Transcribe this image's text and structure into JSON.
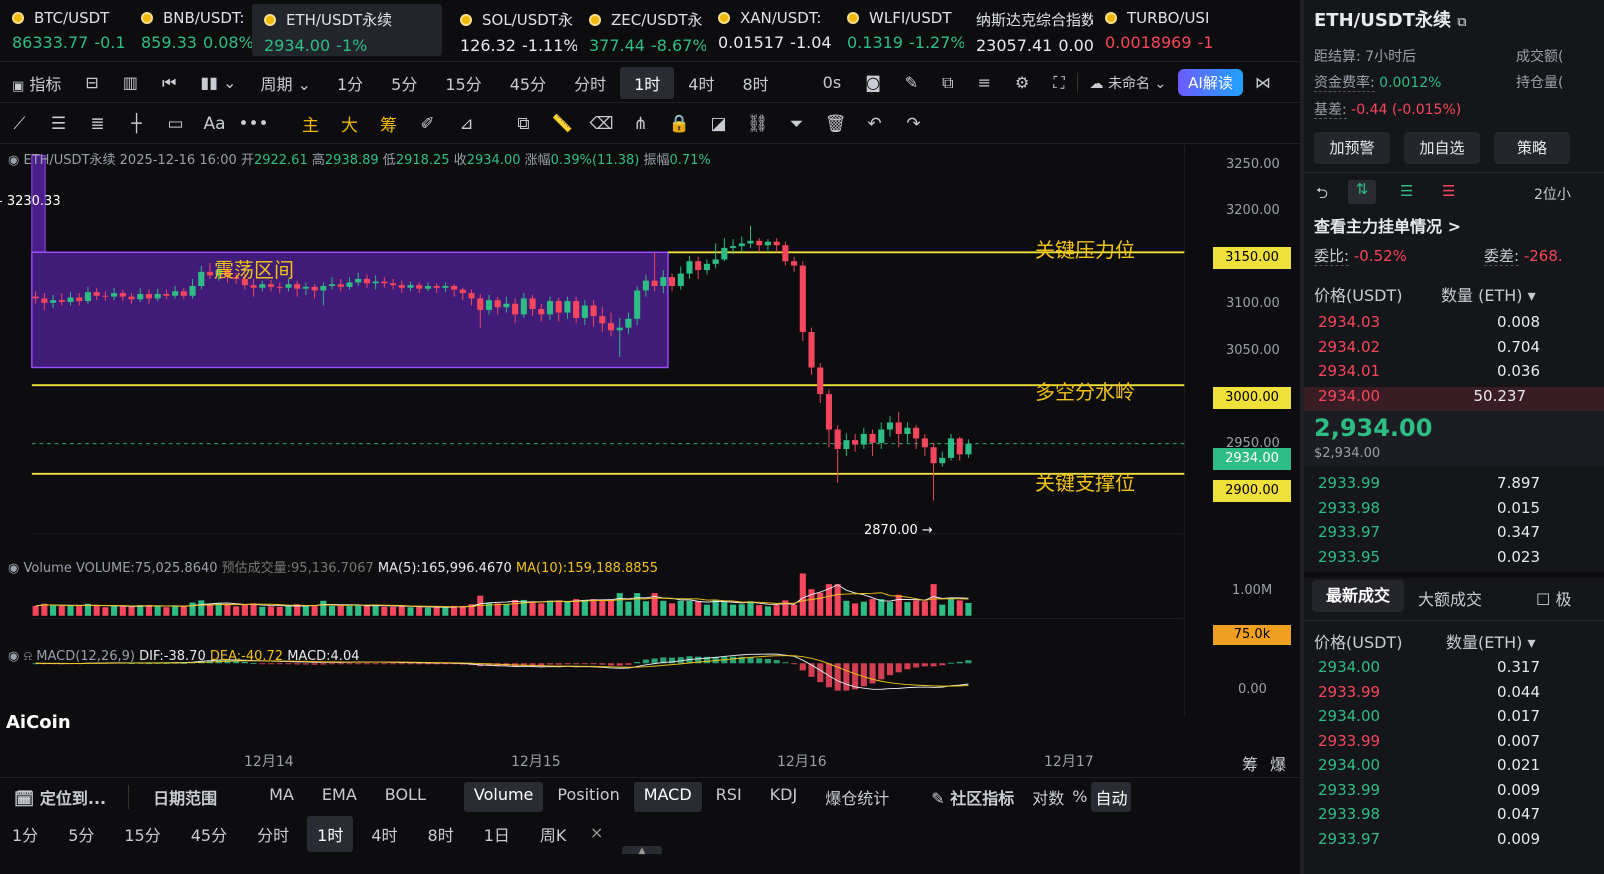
{
  "tickers": [
    {
      "name": "BTC/USDT",
      "price": "86333.77",
      "change": "-0.1",
      "pc": "green"
    },
    {
      "name": "BNB/USDT:",
      "price": "859.33",
      "change": "0.08%",
      "pc": "green"
    },
    {
      "name": "ETH/USDT永续",
      "price": "2934.00",
      "change": "-1%",
      "pc": "green",
      "active": true
    },
    {
      "name": "SOL/USDT永",
      "price": "126.32",
      "change": "-1.11%",
      "pc": "w"
    },
    {
      "name": "ZEC/USDT永",
      "price": "377.44",
      "change": "-8.67%",
      "pc": "green"
    },
    {
      "name": "XAN/USDT:",
      "price": "0.01517",
      "change": "-1.04",
      "pc": "w"
    },
    {
      "name": "WLFI/USDT",
      "price": "0.1319",
      "change": "-1.27%",
      "pc": "green"
    },
    {
      "name": "纳斯达克综合指数",
      "price": "23057.41",
      "change": "0.00",
      "pc": "w",
      "noicon": true
    },
    {
      "name": "TURBO/USI",
      "price": "0.0018969",
      "change": "-1",
      "pc": "r"
    }
  ],
  "plus_icon": "plus-icon",
  "toolbar1": {
    "indicator": "指标",
    "period": "周期",
    "tf": [
      "1分",
      "5分",
      "15分",
      "45分",
      "分时",
      "1时",
      "4时",
      "8时"
    ],
    "selected_tf": "1时",
    "zero_s": "0s",
    "layout_name": "未命名",
    "ai": "AI解读"
  },
  "toolbar2": {
    "main": "主",
    "big": "大",
    "chip": "筹",
    "text_tool": "Aa"
  },
  "info": {
    "symbol": "ETH/USDT永续",
    "time": "2025-12-16 16:00",
    "open_label": "开",
    "open": "2922.61",
    "high_label": "高",
    "high": "2938.89",
    "low_label": "低",
    "low": "2918.25",
    "close_label": "收",
    "close": "2934.00",
    "chg_label": "涨幅",
    "chg": "0.39%(11.38)",
    "amp_label": "振幅",
    "amp": "0.71%"
  },
  "annotations": {
    "range": "震荡区间",
    "resistance": "关键压力位",
    "divide": "多空分水岭",
    "support": "关键支撑位",
    "prev_high": "3230.33",
    "low_mark": "2870.00 →"
  },
  "price_axis": [
    "3250.00",
    "3200.00",
    "3150.00",
    "3100.00",
    "3050.00",
    "3000.00",
    "2950.00",
    "2934.00",
    "2900.00"
  ],
  "level_tags": {
    "l3150": "3150.00",
    "l3000": "3000.00",
    "l2934": "2934.00",
    "l2900": "2900.00"
  },
  "volume": {
    "label": "Volume",
    "vol": "VOLUME:75,025.8640",
    "est": "预估成交量:95,136.7067",
    "ma5": "MA(5):165,996.4670",
    "ma10": "MA(10):159,188.8855",
    "axis": "1.00M",
    "tag": "75.0k"
  },
  "macd": {
    "label": "MACD(12,26,9)",
    "dif": "DIF:-38.70",
    "dea": "DEA:-40.72",
    "macd": "MACD:4.04",
    "axis": "0.00"
  },
  "watermark": "AiCoin",
  "dates": [
    "12月14",
    "12月15",
    "12月16",
    "12月17"
  ],
  "axis_btns": {
    "auto": "筹",
    "burst": "爆"
  },
  "bottom1": {
    "locate": "定位到...",
    "date_range": "日期范围",
    "items": [
      "MA",
      "EMA",
      "BOLL",
      "Volume",
      "Position",
      "MACD",
      "RSI",
      "KDJ",
      "爆仓统计"
    ],
    "community": "社区指标",
    "log": "对数",
    "pct": "%",
    "auto": "自动"
  },
  "bottom2": {
    "tf": [
      "1分",
      "5分",
      "15分",
      "45分",
      "分时",
      "1时",
      "4时",
      "8时",
      "1日",
      "周K"
    ],
    "selected": "1时"
  },
  "right": {
    "title": "ETH/USDT永续",
    "settle_label": "距结算:",
    "settle": "7小时后",
    "vol_label": "成交额(",
    "funding_label": "资金费率:",
    "funding": "0.0012%",
    "oi_label": "持仓量(",
    "basis_label": "基差:",
    "basis": "-0.44 (-0.015%)",
    "btn_alert": "加预警",
    "btn_fav": "加自选",
    "btn_strategy": "策略",
    "precision": "2位小",
    "depth_link": "查看主力挂单情况 >",
    "ratio_label": "委比:",
    "ratio": "-0.52%",
    "diff_label": "委差:",
    "diff": "-268.",
    "col_price": "价格(USDT)",
    "col_qty": "数量 (ETH) ▾",
    "asks": [
      {
        "p": "2934.03",
        "q": "0.008"
      },
      {
        "p": "2934.02",
        "q": "0.704"
      },
      {
        "p": "2934.01",
        "q": "0.036"
      },
      {
        "p": "2934.00",
        "q": "50.237"
      }
    ],
    "last": "2,934.00",
    "last_usd": "$2,934.00",
    "bids": [
      {
        "p": "2933.99",
        "q": "7.897"
      },
      {
        "p": "2933.98",
        "q": "0.015"
      },
      {
        "p": "2933.97",
        "q": "0.347"
      },
      {
        "p": "2933.95",
        "q": "0.023"
      }
    ],
    "tab_latest": "最新成交",
    "tab_big": "大额成交",
    "tab_extra": "极",
    "trades_col_price": "价格(USDT)",
    "trades_col_qty": "数量(ETH) ▾",
    "trades": [
      {
        "p": "2934.00",
        "q": "0.317",
        "c": "green"
      },
      {
        "p": "2933.99",
        "q": "0.044",
        "c": "red"
      },
      {
        "p": "2934.00",
        "q": "0.017",
        "c": "green"
      },
      {
        "p": "2933.99",
        "q": "0.007",
        "c": "red"
      },
      {
        "p": "2934.00",
        "q": "0.021",
        "c": "green"
      },
      {
        "p": "2933.99",
        "q": "0.009",
        "c": "green"
      },
      {
        "p": "2933.98",
        "q": "0.047",
        "c": "green"
      },
      {
        "p": "2933.97",
        "q": "0.009",
        "c": "green"
      }
    ]
  },
  "colors": {
    "up": "#2ebd85",
    "down": "#f6465d",
    "level": "#f0e03a",
    "range_fill": "#4a1f8a",
    "range_border": "#9b4dff"
  },
  "chart_data": {
    "type": "candlestick",
    "interval": "1h",
    "levels": [
      3150,
      3000,
      2900
    ],
    "range_box": {
      "top": 3150,
      "bottom": 3020
    },
    "last_close": 2934.0,
    "day_low": 2870.0,
    "prev_high": 3230.33,
    "y_range": [
      2830,
      3270
    ],
    "candles": [
      [
        3100,
        3098,
        3092,
        3106
      ],
      [
        3098,
        3093,
        3085,
        3104
      ],
      [
        3093,
        3096,
        3087,
        3102
      ],
      [
        3096,
        3094,
        3090,
        3104
      ],
      [
        3094,
        3099,
        3090,
        3105
      ],
      [
        3099,
        3095,
        3090,
        3104
      ],
      [
        3095,
        3105,
        3092,
        3111
      ],
      [
        3105,
        3101,
        3096,
        3110
      ],
      [
        3101,
        3100,
        3095,
        3106
      ],
      [
        3100,
        3104,
        3096,
        3110
      ],
      [
        3104,
        3100,
        3095,
        3108
      ],
      [
        3100,
        3097,
        3092,
        3104
      ],
      [
        3097,
        3103,
        3094,
        3110
      ],
      [
        3103,
        3098,
        3092,
        3108
      ],
      [
        3098,
        3103,
        3095,
        3109
      ],
      [
        3103,
        3101,
        3097,
        3108
      ],
      [
        3101,
        3106,
        3098,
        3112
      ],
      [
        3106,
        3101,
        3097,
        3110
      ],
      [
        3101,
        3112,
        3098,
        3120
      ],
      [
        3112,
        3128,
        3108,
        3135
      ],
      [
        3128,
        3124,
        3120,
        3138
      ],
      [
        3124,
        3130,
        3118,
        3139
      ],
      [
        3130,
        3122,
        3116,
        3133
      ],
      [
        3122,
        3120,
        3114,
        3127
      ],
      [
        3120,
        3113,
        3108,
        3126
      ],
      [
        3113,
        3110,
        3100,
        3120
      ],
      [
        3110,
        3114,
        3106,
        3118
      ],
      [
        3114,
        3111,
        3106,
        3119
      ],
      [
        3111,
        3110,
        3104,
        3116
      ],
      [
        3110,
        3114,
        3106,
        3120
      ],
      [
        3114,
        3109,
        3100,
        3118
      ],
      [
        3109,
        3111,
        3102,
        3116
      ],
      [
        3111,
        3107,
        3098,
        3114
      ],
      [
        3107,
        3112,
        3090,
        3116
      ],
      [
        3112,
        3114,
        3108,
        3122
      ],
      [
        3114,
        3111,
        3106,
        3120
      ],
      [
        3111,
        3116,
        3108,
        3122
      ],
      [
        3116,
        3120,
        3112,
        3127
      ],
      [
        3120,
        3115,
        3110,
        3125
      ],
      [
        3115,
        3117,
        3108,
        3124
      ],
      [
        3117,
        3115,
        3110,
        3122
      ],
      [
        3115,
        3113,
        3108,
        3120
      ],
      [
        3113,
        3110,
        3104,
        3118
      ],
      [
        3110,
        3113,
        3106,
        3117
      ],
      [
        3113,
        3109,
        3104,
        3116
      ],
      [
        3109,
        3112,
        3106,
        3116
      ],
      [
        3112,
        3110,
        3104,
        3115
      ],
      [
        3110,
        3112,
        3105,
        3116
      ],
      [
        3112,
        3108,
        3100,
        3114
      ],
      [
        3108,
        3104,
        3096,
        3110
      ],
      [
        3104,
        3098,
        3090,
        3108
      ],
      [
        3098,
        3085,
        3065,
        3103
      ],
      [
        3085,
        3096,
        3080,
        3102
      ],
      [
        3096,
        3088,
        3080,
        3100
      ],
      [
        3088,
        3092,
        3082,
        3100
      ],
      [
        3092,
        3080,
        3070,
        3098
      ],
      [
        3080,
        3098,
        3076,
        3104
      ],
      [
        3098,
        3086,
        3078,
        3102
      ],
      [
        3086,
        3080,
        3072,
        3092
      ],
      [
        3080,
        3095,
        3074,
        3100
      ],
      [
        3095,
        3082,
        3072,
        3099
      ],
      [
        3082,
        3095,
        3075,
        3100
      ],
      [
        3095,
        3076,
        3070,
        3100
      ],
      [
        3076,
        3090,
        3068,
        3096
      ],
      [
        3090,
        3078,
        3066,
        3096
      ],
      [
        3078,
        3070,
        3060,
        3088
      ],
      [
        3070,
        3062,
        3055,
        3082
      ],
      [
        3062,
        3065,
        3032,
        3076
      ],
      [
        3065,
        3075,
        3058,
        3082
      ],
      [
        3075,
        3107,
        3068,
        3112
      ],
      [
        3107,
        3118,
        3100,
        3125
      ],
      [
        3118,
        3112,
        3106,
        3150
      ],
      [
        3112,
        3122,
        3104,
        3130
      ],
      [
        3122,
        3112,
        3106,
        3126
      ],
      [
        3112,
        3126,
        3108,
        3134
      ],
      [
        3126,
        3140,
        3120,
        3146
      ],
      [
        3140,
        3130,
        3120,
        3145
      ],
      [
        3130,
        3137,
        3125,
        3142
      ],
      [
        3137,
        3142,
        3132,
        3160
      ],
      [
        3142,
        3155,
        3140,
        3166
      ],
      [
        3155,
        3157,
        3148,
        3165
      ],
      [
        3157,
        3160,
        3150,
        3168
      ],
      [
        3160,
        3163,
        3155,
        3180
      ],
      [
        3163,
        3158,
        3150,
        3166
      ],
      [
        3158,
        3162,
        3152,
        3165
      ],
      [
        3162,
        3158,
        3150,
        3166
      ],
      [
        3158,
        3140,
        3135,
        3162
      ],
      [
        3140,
        3135,
        3128,
        3145
      ],
      [
        3135,
        3060,
        3050,
        3140
      ],
      [
        3060,
        3020,
        3012,
        3065
      ],
      [
        3020,
        2990,
        2980,
        3025
      ],
      [
        2990,
        2950,
        2930,
        2995
      ],
      [
        2950,
        2928,
        2890,
        2955
      ],
      [
        2928,
        2938,
        2920,
        2946
      ],
      [
        2938,
        2933,
        2925,
        2945
      ],
      [
        2933,
        2945,
        2928,
        2952
      ],
      [
        2945,
        2935,
        2920,
        2950
      ],
      [
        2935,
        2950,
        2928,
        2958
      ],
      [
        2950,
        2958,
        2942,
        2965
      ],
      [
        2958,
        2945,
        2930,
        2970
      ],
      [
        2945,
        2952,
        2935,
        2958
      ],
      [
        2952,
        2940,
        2928,
        2955
      ],
      [
        2940,
        2930,
        2920,
        2945
      ],
      [
        2930,
        2912,
        2870,
        2935
      ],
      [
        2912,
        2918,
        2908,
        2925
      ],
      [
        2918,
        2940,
        2915,
        2945
      ],
      [
        2940,
        2922,
        2915,
        2942
      ],
      [
        2922,
        2934,
        2918,
        2939
      ]
    ]
  }
}
